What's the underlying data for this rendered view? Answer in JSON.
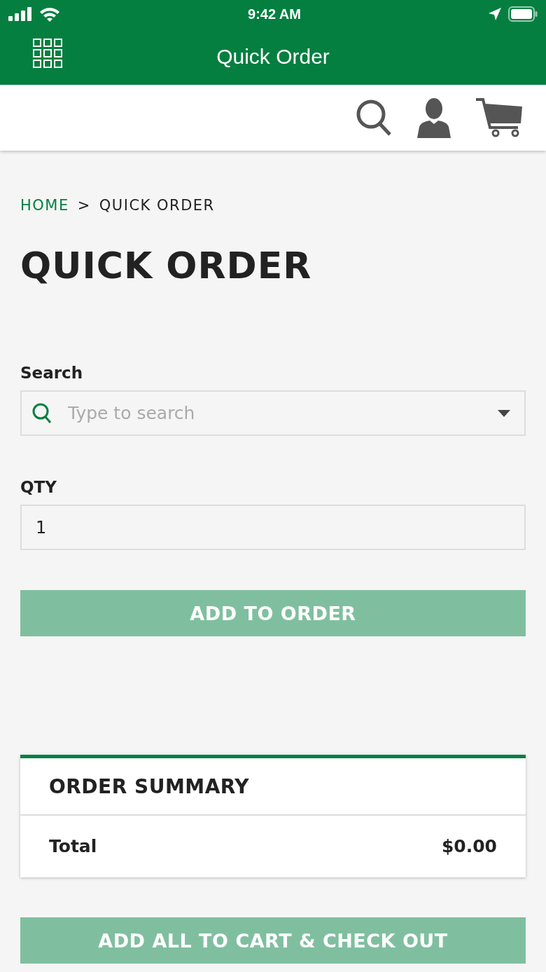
{
  "status_bar": {
    "time": "9:42 AM"
  },
  "header": {
    "title": "Quick Order"
  },
  "breadcrumb": [
    {
      "label": "HOME",
      "kind": "link"
    },
    {
      "label": ">",
      "kind": "separator"
    },
    {
      "label": "QUICK ORDER",
      "kind": "current"
    }
  ],
  "page_title": "QUICK ORDER",
  "search": {
    "label": "Search",
    "placeholder": "Type to search"
  },
  "qty": {
    "label": "QTY",
    "value": "1"
  },
  "add_button": {
    "label": "ADD TO ORDER",
    "disabled": true
  },
  "order_summary": {
    "title": "ORDER SUMMARY",
    "total_label": "Total",
    "total_value": "$0.00"
  },
  "checkout_button": {
    "label": "ADD ALL TO CART & CHECK OUT",
    "disabled": true
  }
}
